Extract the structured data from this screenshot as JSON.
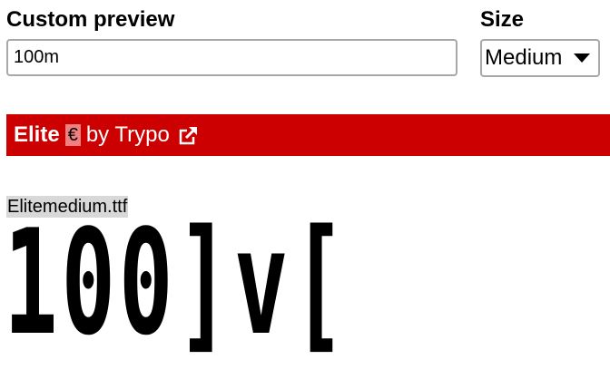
{
  "custom_preview": {
    "label": "Custom preview",
    "input_value": "100m"
  },
  "size": {
    "label": "Size",
    "selected": "Medium"
  },
  "font_bar": {
    "name": "Elite",
    "euro_symbol": "€",
    "byline": " by Trypo",
    "background_color": "#cc0000",
    "icon": "external-link-icon"
  },
  "preview": {
    "file_name": "Elitemedium.ttf",
    "rendered_text": "100]v["
  }
}
